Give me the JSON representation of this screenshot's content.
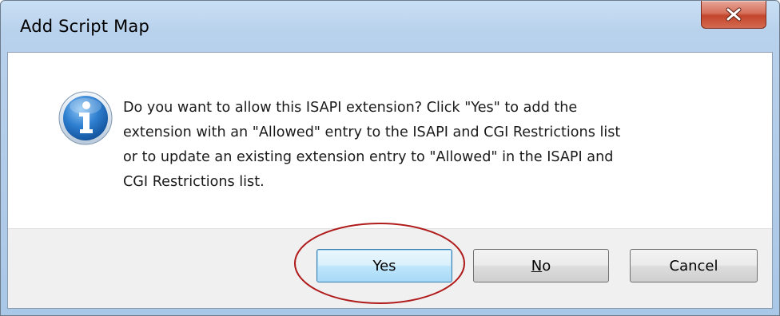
{
  "window": {
    "title": "Add Script Map"
  },
  "dialog": {
    "icon": "information-icon",
    "message": "Do you want to allow this ISAPI extension? Click \"Yes\" to add the\nextension with an \"Allowed\" entry to the ISAPI and CGI Restrictions list\nor to update an existing extension entry to \"Allowed\" in the ISAPI and\nCGI Restrictions list."
  },
  "buttons": {
    "yes": "Yes",
    "no_underlined": "N",
    "no_rest": "o",
    "cancel": "Cancel"
  },
  "colors": {
    "annotation_circle": "#b01c1c",
    "close_button": "#c3452c",
    "default_button_border": "#3c7fb1"
  }
}
